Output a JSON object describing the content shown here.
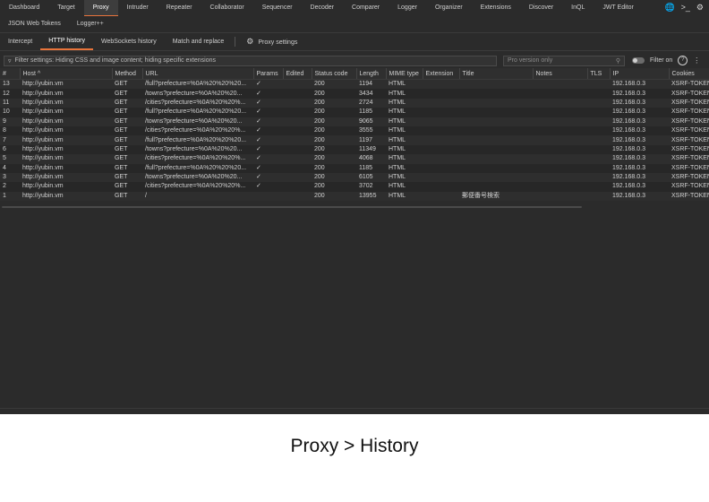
{
  "top_nav": [
    "Dashboard",
    "Target",
    "Proxy",
    "Intruder",
    "Repeater",
    "Collaborator",
    "Sequencer",
    "Decoder",
    "Comparer",
    "Logger",
    "Organizer",
    "Extensions",
    "Discover",
    "InQL",
    "JWT Editor"
  ],
  "top_nav_active": "Proxy",
  "top_icons": {
    "globe": "globe-icon",
    "terminal": "terminal-icon",
    "settings": "gear-icon"
  },
  "extension_tabs": [
    "JSON Web Tokens",
    "Logger++"
  ],
  "proxy_tabs": [
    "Intercept",
    "HTTP history",
    "WebSockets history",
    "Match and replace"
  ],
  "proxy_settings_label": "Proxy settings",
  "filter": {
    "text": "Filter settings: Hiding CSS and image content; hiding specific extensions",
    "search_placeholder": "Pro version only",
    "filter_on_label": "Filter on"
  },
  "columns": [
    "#",
    "Host ^",
    "Method",
    "URL",
    "Params",
    "Edited",
    "Status code",
    "Length",
    "MIME type",
    "Extension",
    "Title",
    "Notes",
    "TLS",
    "IP",
    "Cookies"
  ],
  "rows": [
    [
      "13",
      "http://yubin.vm",
      "GET",
      "/full?prefecture=%0A%20%20%20...",
      "✓",
      "",
      "200",
      "1194",
      "HTML",
      "",
      "",
      "",
      "",
      "192.168.0.3",
      "XSRF-TOKEN"
    ],
    [
      "12",
      "http://yubin.vm",
      "GET",
      "/towns?prefecture=%0A%20%20...",
      "✓",
      "",
      "200",
      "3434",
      "HTML",
      "",
      "",
      "",
      "",
      "192.168.0.3",
      "XSRF-TOKEN"
    ],
    [
      "11",
      "http://yubin.vm",
      "GET",
      "/cities?prefecture=%0A%20%20%...",
      "✓",
      "",
      "200",
      "2724",
      "HTML",
      "",
      "",
      "",
      "",
      "192.168.0.3",
      "XSRF-TOKEN"
    ],
    [
      "10",
      "http://yubin.vm",
      "GET",
      "/full?prefecture=%0A%20%20%20...",
      "✓",
      "",
      "200",
      "1185",
      "HTML",
      "",
      "",
      "",
      "",
      "192.168.0.3",
      "XSRF-TOKEN"
    ],
    [
      "9",
      "http://yubin.vm",
      "GET",
      "/towns?prefecture=%0A%20%20...",
      "✓",
      "",
      "200",
      "9065",
      "HTML",
      "",
      "",
      "",
      "",
      "192.168.0.3",
      "XSRF-TOKEN"
    ],
    [
      "8",
      "http://yubin.vm",
      "GET",
      "/cities?prefecture=%0A%20%20%...",
      "✓",
      "",
      "200",
      "3555",
      "HTML",
      "",
      "",
      "",
      "",
      "192.168.0.3",
      "XSRF-TOKEN"
    ],
    [
      "7",
      "http://yubin.vm",
      "GET",
      "/full?prefecture=%0A%20%20%20...",
      "✓",
      "",
      "200",
      "1197",
      "HTML",
      "",
      "",
      "",
      "",
      "192.168.0.3",
      "XSRF-TOKEN"
    ],
    [
      "6",
      "http://yubin.vm",
      "GET",
      "/towns?prefecture=%0A%20%20...",
      "✓",
      "",
      "200",
      "11349",
      "HTML",
      "",
      "",
      "",
      "",
      "192.168.0.3",
      "XSRF-TOKEN"
    ],
    [
      "5",
      "http://yubin.vm",
      "GET",
      "/cities?prefecture=%0A%20%20%...",
      "✓",
      "",
      "200",
      "4068",
      "HTML",
      "",
      "",
      "",
      "",
      "192.168.0.3",
      "XSRF-TOKEN"
    ],
    [
      "4",
      "http://yubin.vm",
      "GET",
      "/full?prefecture=%0A%20%20%20...",
      "✓",
      "",
      "200",
      "1185",
      "HTML",
      "",
      "",
      "",
      "",
      "192.168.0.3",
      "XSRF-TOKEN"
    ],
    [
      "3",
      "http://yubin.vm",
      "GET",
      "/towns?prefecture=%0A%20%20...",
      "✓",
      "",
      "200",
      "6105",
      "HTML",
      "",
      "",
      "",
      "",
      "192.168.0.3",
      "XSRF-TOKEN"
    ],
    [
      "2",
      "http://yubin.vm",
      "GET",
      "/cities?prefecture=%0A%20%20%...",
      "✓",
      "",
      "200",
      "3702",
      "HTML",
      "",
      "",
      "",
      "",
      "192.168.0.3",
      "XSRF-TOKEN"
    ],
    [
      "1",
      "http://yubin.vm",
      "GET",
      "/",
      "",
      "",
      "200",
      "13955",
      "HTML",
      "",
      "郵便番号検索",
      "",
      "",
      "192.168.0.3",
      "XSRF-TOKEN"
    ]
  ],
  "caption": "Proxy > History"
}
